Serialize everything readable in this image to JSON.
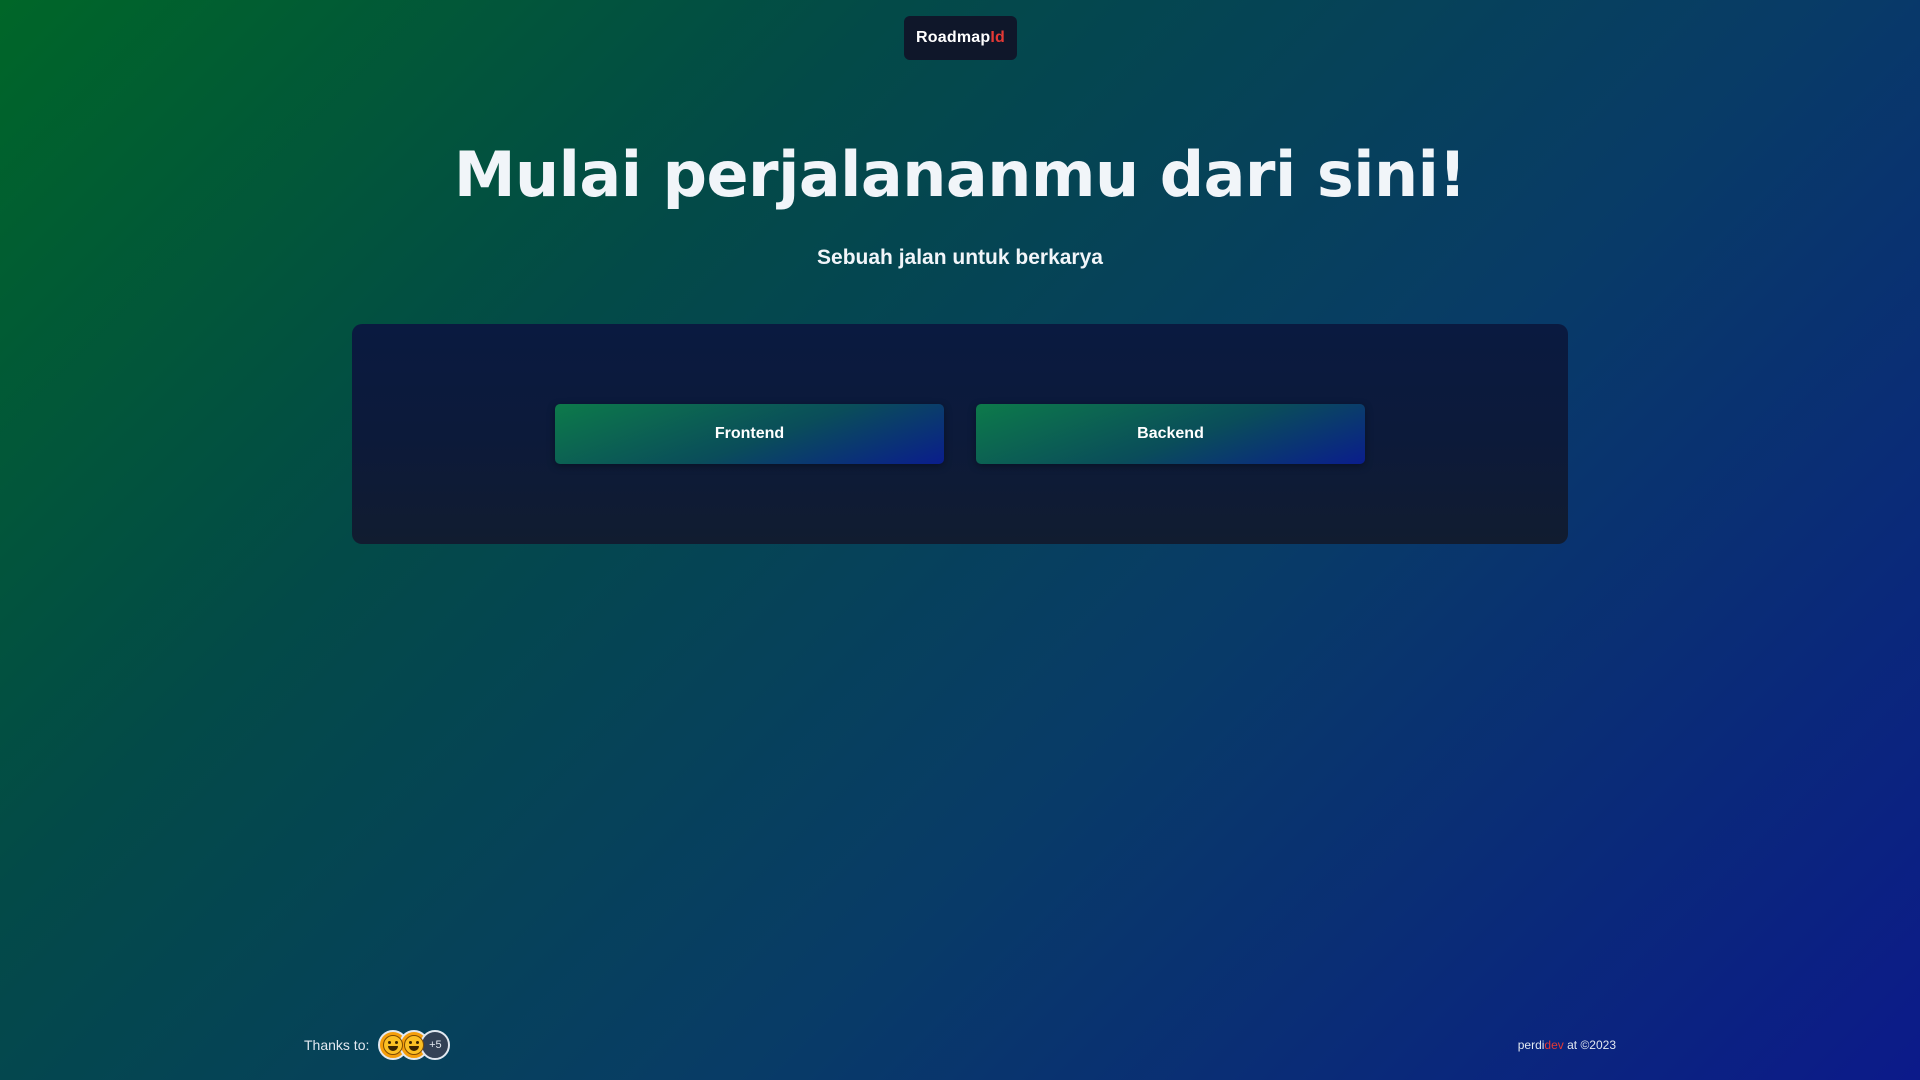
{
  "header": {
    "logo_main": "Roadmap",
    "logo_accent": "Id"
  },
  "hero": {
    "title": "Mulai perjalananmu dari sini!",
    "subtitle": "Sebuah jalan untuk berkarya"
  },
  "paths": [
    {
      "label": "Frontend"
    },
    {
      "label": "Backend"
    }
  ],
  "footer": {
    "thanks_label": "Thanks to:",
    "contributors": [
      {
        "icon": "grinning-face-icon"
      },
      {
        "icon": "grinning-face-icon"
      }
    ],
    "more_count": "+5",
    "credit_prefix": "perdi",
    "credit_accent": "dev",
    "credit_suffix": " at ©2023"
  },
  "colors": {
    "accent": "#e53935",
    "panel": "#0c1a3a",
    "button_gradient_start": "#0d7a4a",
    "button_gradient_end": "#0a1d8c"
  }
}
